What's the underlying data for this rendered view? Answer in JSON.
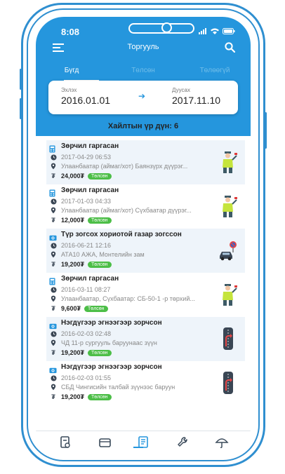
{
  "status": {
    "time": "8:08"
  },
  "header": {
    "title": "Торгууль"
  },
  "tabs": [
    {
      "label": "Бүгд",
      "active": true
    },
    {
      "label": "Төлсөн",
      "active": false
    },
    {
      "label": "Төлөөгүй",
      "active": false
    }
  ],
  "date_range": {
    "start_label": "Эхлэх",
    "start_value": "2016.01.01",
    "end_label": "Дуусах",
    "end_value": "2017.11.10"
  },
  "result_count_text": "Хайлтын үр дүн: 6",
  "fines": [
    {
      "title": "Зөрчил гаргасан",
      "datetime": "2017-04-29 06:53",
      "location": "Улаанбаатар (аймаг/хот) Баянзүрх дүүрэг...",
      "amount": "24,000₮",
      "status": "Төлсөн",
      "type_icon": "calculator-icon",
      "picture": "traffic-police-icon"
    },
    {
      "title": "Зөрчил гаргасан",
      "datetime": "2017-01-03 04:33",
      "location": "Улаанбаатар (аймаг/хот) Сүхбаатар дүүрэг...",
      "amount": "12,000₮",
      "status": "Төлсөн",
      "type_icon": "calculator-icon",
      "picture": "traffic-police-icon"
    },
    {
      "title": "Түр зогсох хориотой газар зогссон",
      "datetime": "2016-06-21 12:16",
      "location": "АТА10 АЖА, Монтелийн зам",
      "amount": "19,200₮",
      "status": "Төлсөн",
      "type_icon": "camera-icon",
      "picture": "no-parking-car-icon"
    },
    {
      "title": "Зөрчил гаргасан",
      "datetime": "2016-03-11 08:27",
      "location": "Улаанбаатар, Сүхбаатар: СБ-50-1 -р төрхий...",
      "amount": "9,600₮",
      "status": "Төлсөн",
      "type_icon": "calculator-icon",
      "picture": "traffic-police-icon"
    },
    {
      "title": "Нэгдүгээр эгнээгээр зорчсон",
      "datetime": "2016-02-03 02:48",
      "location": "ЧД 11-р сургууль баруунаас зүүн",
      "amount": "19,200₮",
      "status": "Төлсөн",
      "type_icon": "camera-icon",
      "picture": "lane-turn-icon"
    },
    {
      "title": "Нэгдүгээр эгнээгээр зорчсон",
      "datetime": "2016-02-03 01:55",
      "location": "СБД Чингисийн талбай зүүнээс баруун",
      "amount": "19,200₮",
      "status": "Төлсөн",
      "type_icon": "camera-icon",
      "picture": "lane-turn-icon"
    }
  ],
  "bottom_nav": [
    {
      "icon": "document-icon",
      "active": false
    },
    {
      "icon": "wallet-icon",
      "active": false
    },
    {
      "icon": "list-icon",
      "active": true
    },
    {
      "icon": "wrench-icon",
      "active": false
    },
    {
      "icon": "umbrella-icon",
      "active": false
    }
  ],
  "colors": {
    "primary": "#2596dd",
    "paid_badge": "#4cbe47",
    "frame": "#2f8fd0"
  }
}
